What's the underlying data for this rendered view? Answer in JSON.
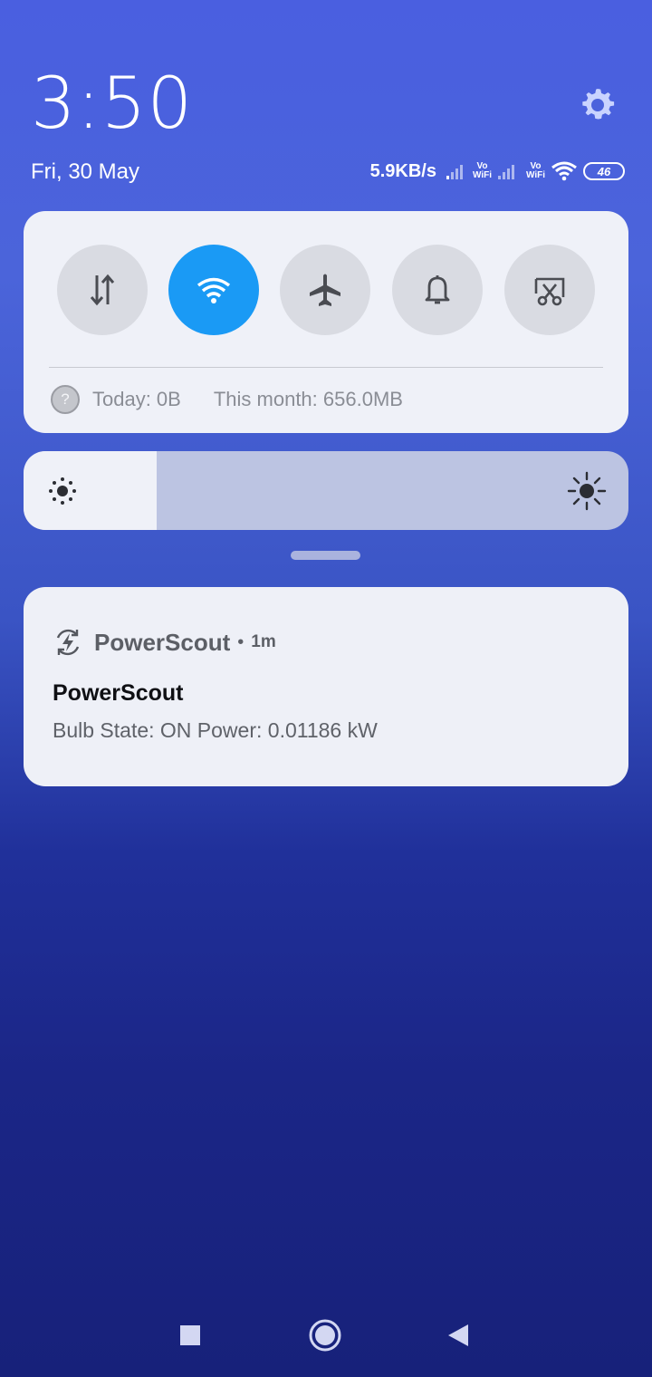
{
  "status": {
    "time": "3:50",
    "date": "Fri, 30 May",
    "network_speed": "5.9KB/s",
    "sim1_label": "Vo WiFi",
    "sim1_vo": "Vo",
    "sim1_wifi": "WiFi",
    "sim2_vo": "Vo",
    "sim2_wifi": "WiFi",
    "battery": "46"
  },
  "quick_settings": {
    "tiles": [
      {
        "name": "mobile-data",
        "icon": "data-arrows-icon",
        "active": false
      },
      {
        "name": "wifi",
        "icon": "wifi-icon",
        "active": true
      },
      {
        "name": "airplane-mode",
        "icon": "airplane-icon",
        "active": false
      },
      {
        "name": "sound",
        "icon": "bell-icon",
        "active": false
      },
      {
        "name": "screenshot",
        "icon": "scissors-icon",
        "active": false
      }
    ],
    "usage_today": "Today: 0B",
    "usage_month": "This month: 656.0MB",
    "active_color": "#1a9af5"
  },
  "brightness": {
    "level_fraction": 0.22
  },
  "notification": {
    "app_name": "PowerScout",
    "separator": "•",
    "time_ago": "1m",
    "title": "PowerScout",
    "body": "Bulb State: ON Power: 0.01186 kW"
  }
}
